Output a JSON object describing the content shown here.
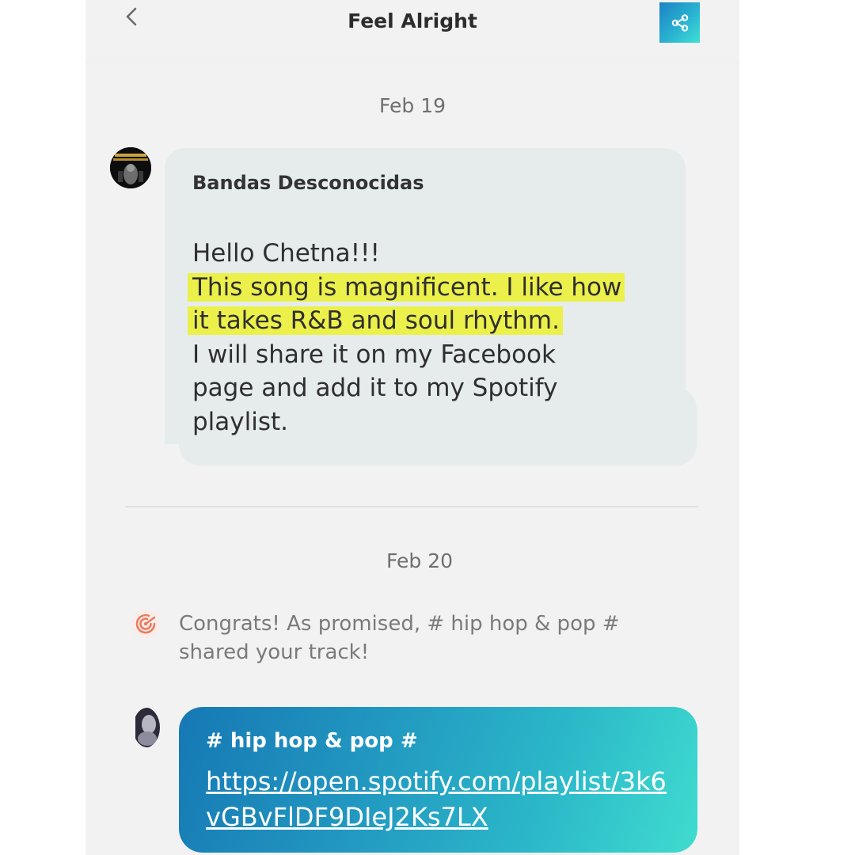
{
  "header": {
    "title": "Feel Alright",
    "back_icon": "chevron-left-icon",
    "share_icon": "share-icon"
  },
  "thread": {
    "date_1": "Feb 19",
    "message_1": {
      "sender": "Bandas Desconocidas",
      "lines": [
        "Hello Chetna!!!",
        "This song is magnificent. I like how",
        "it takes R&B and soul rhythm.",
        "I will share it on my Facebook",
        "page and add it to my Spotify",
        "playlist."
      ]
    },
    "date_2": "Feb 20",
    "notice": {
      "icon": "target-icon",
      "text": "Congrats! As promised, # hip hop & pop # shared your track!"
    },
    "message_2": {
      "title": "# hip hop & pop #",
      "link": "https://open.spotify.com/playlist/3k6vGBvFlDF9DIeJ2Ks7LX"
    }
  },
  "colors": {
    "highlight": "#ecf04a",
    "bubble": "#e6eceb",
    "accent_gradient_start": "#1678b4",
    "accent_gradient_end": "#40dccf",
    "notice_icon": "#f0785a"
  }
}
